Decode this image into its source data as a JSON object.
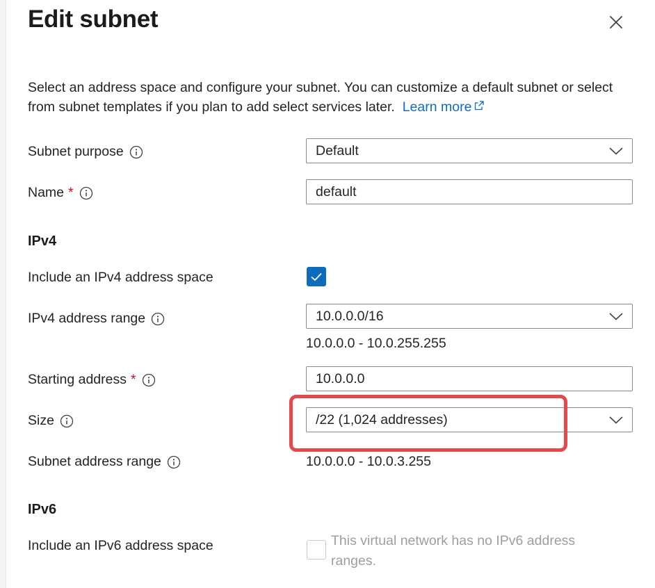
{
  "panel": {
    "title": "Edit subnet",
    "close_icon": "close-icon"
  },
  "description": {
    "text": "Select an address space and configure your subnet. You can customize a default subnet or select from subnet templates if you plan to add select services later.",
    "link_label": "Learn more",
    "link_icon": "external-link-icon"
  },
  "subnet_purpose": {
    "label": "Subnet purpose",
    "value": "Default"
  },
  "name": {
    "label": "Name",
    "required_mark": "*",
    "value": "default"
  },
  "ipv4": {
    "section_title": "IPv4",
    "include_label": "Include an IPv4 address space",
    "include_checked": true,
    "range_label": "IPv4 address range",
    "range_value": "10.0.0.0/16",
    "range_span": "10.0.0.0 - 10.0.255.255",
    "starting_label": "Starting address",
    "starting_required_mark": "*",
    "starting_value": "10.0.0.0",
    "size_label": "Size",
    "size_value": "/22 (1,024 addresses)",
    "subnet_range_label": "Subnet address range",
    "subnet_range_value": "10.0.0.0 - 10.0.3.255"
  },
  "ipv6": {
    "section_title": "IPv6",
    "include_label": "Include an IPv6 address space",
    "include_checked": false,
    "disabled_note": "This virtual network has no IPv6 address ranges."
  },
  "colors": {
    "accent": "#0f6cbd",
    "required": "#c50f1f",
    "highlight": "#e5484d"
  }
}
